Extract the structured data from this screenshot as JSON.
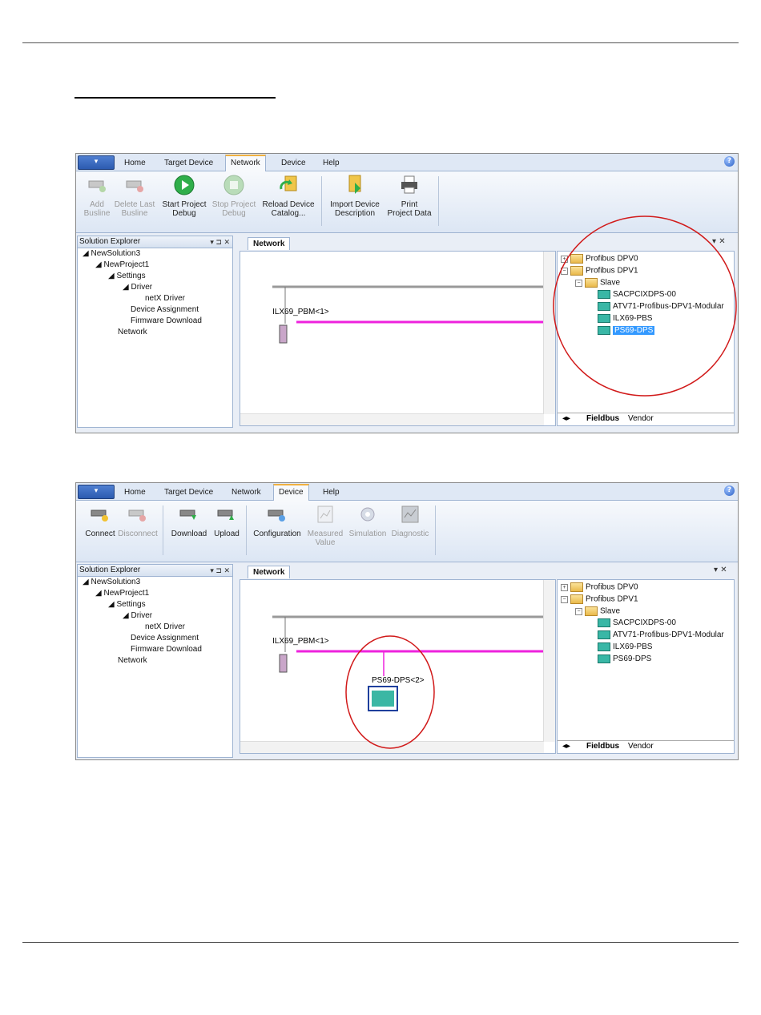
{
  "shot1": {
    "app_menu": "▾",
    "tabs": [
      "Home",
      "Target Device",
      "Network",
      "Device",
      "Help"
    ],
    "active_tab": "Network",
    "help": "?",
    "ribbon": [
      {
        "l1": "Add",
        "l2": "Busline"
      },
      {
        "l1": "Delete Last",
        "l2": "Busline"
      },
      {
        "l1": "Start Project",
        "l2": "Debug"
      },
      {
        "l1": "Stop Project",
        "l2": "Debug"
      },
      {
        "l1": "Reload Device",
        "l2": "Catalog..."
      },
      {
        "l1": "Import Device",
        "l2": "Description"
      },
      {
        "l1": "Print",
        "l2": "Project Data"
      }
    ],
    "solution_explorer_title": "Solution Explorer",
    "pane_controls": "▾ ⊐ ✕",
    "doc_tab": "Network",
    "device_label": "ILX69_PBM<1>",
    "catalog_tabs": [
      "Fieldbus",
      "Vendor"
    ]
  },
  "shot2": {
    "app_menu": "▾",
    "tabs": [
      "Home",
      "Target Device",
      "Network",
      "Device",
      "Help"
    ],
    "active_tab": "Device",
    "help": "?",
    "ribbon": [
      {
        "l1": "Connect",
        "l2": ""
      },
      {
        "l1": "Disconnect",
        "l2": ""
      },
      {
        "l1": "Download",
        "l2": ""
      },
      {
        "l1": "Upload",
        "l2": ""
      },
      {
        "l1": "Configuration",
        "l2": ""
      },
      {
        "l1": "Measured",
        "l2": "Value"
      },
      {
        "l1": "Simulation",
        "l2": ""
      },
      {
        "l1": "Diagnostic",
        "l2": ""
      }
    ],
    "solution_explorer_title": "Solution Explorer",
    "pane_controls": "▾ ⊐ ✕",
    "doc_tab": "Network",
    "device_label": "ILX69_PBM<1>",
    "slave_label": "PS69-DPS<2>",
    "catalog_tabs": [
      "Fieldbus",
      "Vendor"
    ]
  },
  "tree": [
    "NewSolution3",
    "NewProject1",
    "Settings",
    "Driver",
    "netX Driver",
    "Device Assignment",
    "Firmware Download",
    "Network"
  ],
  "catalog": [
    "Profibus DPV0",
    "Profibus DPV1",
    "Slave",
    "SACPCIXDPS-00",
    "ATV71-Profibus-DPV1-Modular",
    "ILX69-PBS",
    "PS69-DPS"
  ],
  "colors": {
    "bus": "#ee22dd",
    "annotation": "#d11a1a",
    "selection": "#3399ff"
  }
}
